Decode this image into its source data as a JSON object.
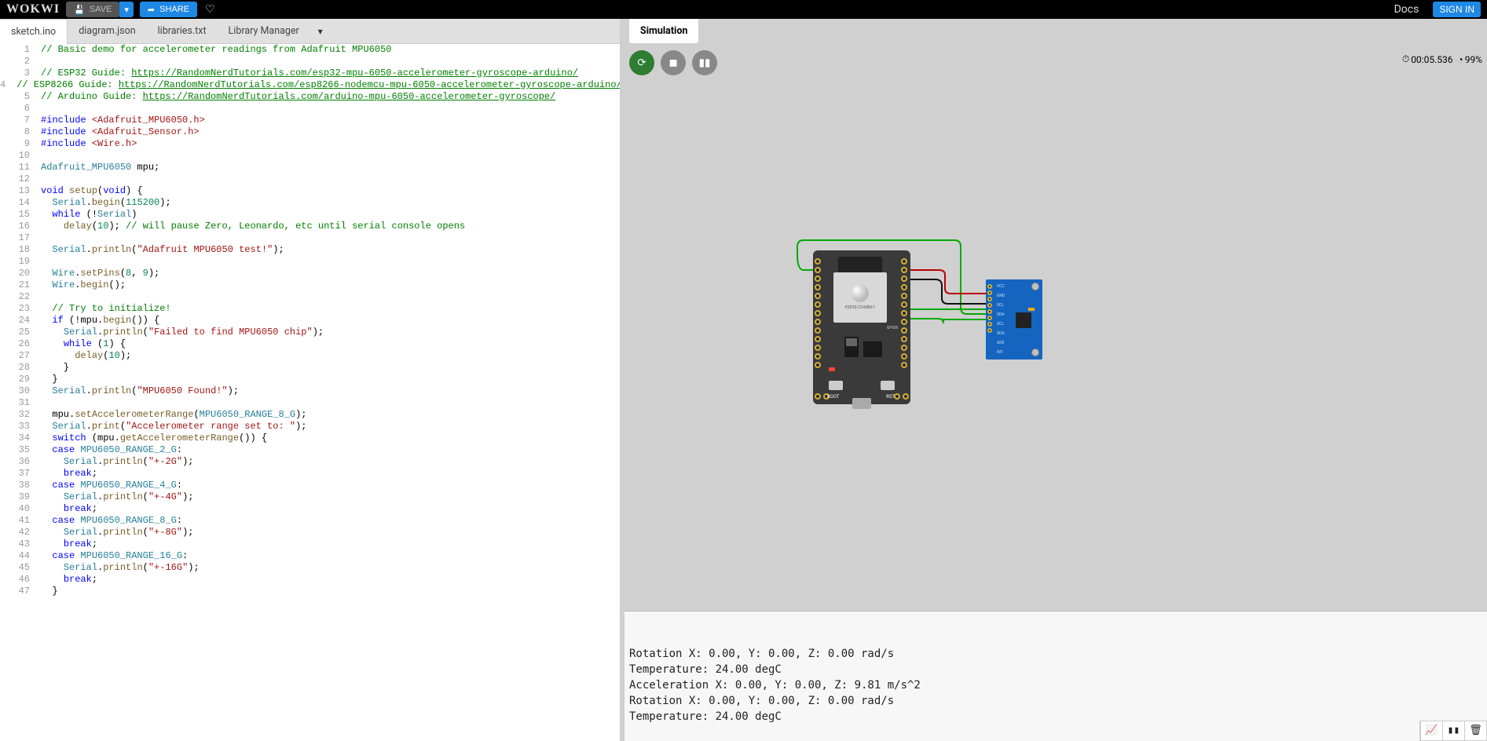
{
  "header": {
    "logo": "WOKWI",
    "save": "SAVE",
    "share": "SHARE",
    "docs": "Docs",
    "signin": "SIGN IN"
  },
  "tabs": {
    "items": [
      "sketch.ino",
      "diagram.json",
      "libraries.txt",
      "Library Manager"
    ],
    "active": 0
  },
  "sim": {
    "tab": "Simulation",
    "time": "00:05.536",
    "perf": "99%"
  },
  "code": [
    {
      "n": 1,
      "h": "<span class='tok-c'>// Basic demo for accelerometer readings from Adafruit MPU6050</span>"
    },
    {
      "n": 2,
      "h": ""
    },
    {
      "n": 3,
      "h": "<span class='tok-c'>// ESP32 Guide: <span class='tok-u'>https://RandomNerdTutorials.com/esp32-mpu-6050-accelerometer-gyroscope-arduino/</span></span>"
    },
    {
      "n": 4,
      "h": "<span class='tok-c'>// ESP8266 Guide: <span class='tok-u'>https://RandomNerdTutorials.com/esp8266-nodemcu-mpu-6050-accelerometer-gyroscope-arduino/</span></span>"
    },
    {
      "n": 5,
      "h": "<span class='tok-c'>// Arduino Guide: <span class='tok-u'>https://RandomNerdTutorials.com/arduino-mpu-6050-accelerometer-gyroscope/</span></span>"
    },
    {
      "n": 6,
      "h": ""
    },
    {
      "n": 7,
      "h": "<span class='tok-k'>#include</span> <span class='tok-inc'>&lt;Adafruit_MPU6050.h&gt;</span>"
    },
    {
      "n": 8,
      "h": "<span class='tok-k'>#include</span> <span class='tok-inc'>&lt;Adafruit_Sensor.h&gt;</span>"
    },
    {
      "n": 9,
      "h": "<span class='tok-k'>#include</span> <span class='tok-inc'>&lt;Wire.h&gt;</span>"
    },
    {
      "n": 10,
      "h": ""
    },
    {
      "n": 11,
      "h": "<span class='tok-t'>Adafruit_MPU6050</span> mpu;"
    },
    {
      "n": 12,
      "h": ""
    },
    {
      "n": 13,
      "h": "<span class='tok-k'>void</span> <span class='tok-f'>setup</span>(<span class='tok-k'>void</span>) {"
    },
    {
      "n": 14,
      "h": "  <span class='tok-t'>Serial</span>.<span class='tok-f'>begin</span>(<span class='tok-n'>115200</span>);"
    },
    {
      "n": 15,
      "h": "  <span class='tok-k'>while</span> (!<span class='tok-t'>Serial</span>)"
    },
    {
      "n": 16,
      "h": "    <span class='tok-f'>delay</span>(<span class='tok-n'>10</span>); <span class='tok-c'>// will pause Zero, Leonardo, etc until serial console opens</span>"
    },
    {
      "n": 17,
      "h": ""
    },
    {
      "n": 18,
      "h": "  <span class='tok-t'>Serial</span>.<span class='tok-f'>println</span>(<span class='tok-s'>\"Adafruit MPU6050 test!\"</span>);"
    },
    {
      "n": 19,
      "h": ""
    },
    {
      "n": 20,
      "h": "  <span class='tok-t'>Wire</span>.<span class='tok-f'>setPins</span>(<span class='tok-n'>8</span>, <span class='tok-n'>9</span>);"
    },
    {
      "n": 21,
      "h": "  <span class='tok-t'>Wire</span>.<span class='tok-f'>begin</span>();"
    },
    {
      "n": 22,
      "h": ""
    },
    {
      "n": 23,
      "h": "  <span class='tok-c'>// Try to initialize!</span>"
    },
    {
      "n": 24,
      "h": "  <span class='tok-k'>if</span> (!mpu.<span class='tok-f'>begin</span>()) {"
    },
    {
      "n": 25,
      "h": "    <span class='tok-t'>Serial</span>.<span class='tok-f'>println</span>(<span class='tok-s'>\"Failed to find MPU6050 chip\"</span>);"
    },
    {
      "n": 26,
      "h": "    <span class='tok-k'>while</span> (<span class='tok-n'>1</span>) {"
    },
    {
      "n": 27,
      "h": "      <span class='tok-f'>delay</span>(<span class='tok-n'>10</span>);"
    },
    {
      "n": 28,
      "h": "    }"
    },
    {
      "n": 29,
      "h": "  }"
    },
    {
      "n": 30,
      "h": "  <span class='tok-t'>Serial</span>.<span class='tok-f'>println</span>(<span class='tok-s'>\"MPU6050 Found!\"</span>);"
    },
    {
      "n": 31,
      "h": ""
    },
    {
      "n": 32,
      "h": "  mpu.<span class='tok-f'>setAccelerometerRange</span>(<span class='tok-t'>MPU6050_RANGE_8_G</span>);"
    },
    {
      "n": 33,
      "h": "  <span class='tok-t'>Serial</span>.<span class='tok-f'>print</span>(<span class='tok-s'>\"Accelerometer range set to: \"</span>);"
    },
    {
      "n": 34,
      "h": "  <span class='tok-k'>switch</span> (mpu.<span class='tok-f'>getAccelerometerRange</span>()) {"
    },
    {
      "n": 35,
      "h": "  <span class='tok-k'>case</span> <span class='tok-t'>MPU6050_RANGE_2_G</span>:"
    },
    {
      "n": 36,
      "h": "    <span class='tok-t'>Serial</span>.<span class='tok-f'>println</span>(<span class='tok-s'>\"+-2G\"</span>);"
    },
    {
      "n": 37,
      "h": "    <span class='tok-k'>break</span>;"
    },
    {
      "n": 38,
      "h": "  <span class='tok-k'>case</span> <span class='tok-t'>MPU6050_RANGE_4_G</span>:"
    },
    {
      "n": 39,
      "h": "    <span class='tok-t'>Serial</span>.<span class='tok-f'>println</span>(<span class='tok-s'>\"+-4G\"</span>);"
    },
    {
      "n": 40,
      "h": "    <span class='tok-k'>break</span>;"
    },
    {
      "n": 41,
      "h": "  <span class='tok-k'>case</span> <span class='tok-t'>MPU6050_RANGE_8_G</span>:"
    },
    {
      "n": 42,
      "h": "    <span class='tok-t'>Serial</span>.<span class='tok-f'>println</span>(<span class='tok-s'>\"+-8G\"</span>);"
    },
    {
      "n": 43,
      "h": "    <span class='tok-k'>break</span>;"
    },
    {
      "n": 44,
      "h": "  <span class='tok-k'>case</span> <span class='tok-t'>MPU6050_RANGE_16_G</span>:"
    },
    {
      "n": 45,
      "h": "    <span class='tok-t'>Serial</span>.<span class='tok-f'>println</span>(<span class='tok-s'>\"+-16G\"</span>);"
    },
    {
      "n": 46,
      "h": "    <span class='tok-k'>break</span>;"
    },
    {
      "n": 47,
      "h": "  }"
    }
  ],
  "mpu_pins": [
    "VCC",
    "GND",
    "SCL",
    "SDA",
    "XCL",
    "XDA",
    "AD0",
    "INT"
  ],
  "esp32": {
    "label": "ESP32-C3-MINI-1",
    "gpio": "GPIO8",
    "boot": "BOOT",
    "rst": "RST"
  },
  "serial": [
    "Rotation X: 0.00, Y: 0.00, Z: 0.00 rad/s",
    "Temperature: 24.00 degC",
    "",
    "Acceleration X: 0.00, Y: 0.00, Z: 9.81 m/s^2",
    "Rotation X: 0.00, Y: 0.00, Z: 0.00 rad/s",
    "Temperature: 24.00 degC"
  ]
}
